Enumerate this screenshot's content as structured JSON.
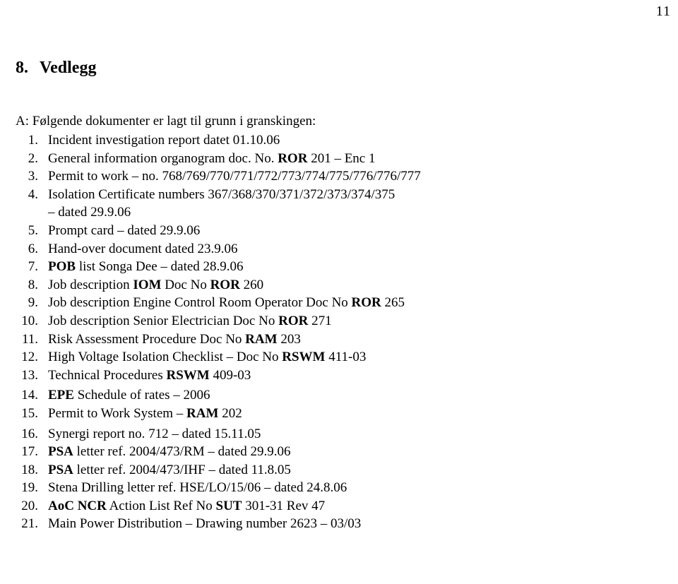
{
  "page": {
    "number": "11"
  },
  "heading": {
    "number": "8.",
    "title": "Vedlegg"
  },
  "intro": {
    "text": "A: Følgende dokumenter er lagt til grunn i granskingen:"
  },
  "list": {
    "items": [
      {
        "num": "1.",
        "text": "Incident investigation report datet 01.10.06"
      },
      {
        "num": "2.",
        "text": "General information organogram doc. No. ROR 201 – Enc 1"
      },
      {
        "num": "3.",
        "text": "Permit to work – no. 768/769/770/771/772/773/774/775/776/776/777"
      },
      {
        "num": "4.",
        "text": "Isolation Certificate numbers 367/368/370/371/372/373/374/375",
        "continuation": "– dated 29.9.06"
      },
      {
        "num": "5.",
        "text": "Prompt card – dated 29.9.06"
      },
      {
        "num": "6.",
        "text": "Hand-over document dated 23.9.06"
      },
      {
        "num": "7.",
        "text": "POB list Songa Dee – dated 28.9.06"
      },
      {
        "num": "8.",
        "text": "Job description IOM Doc No ROR 260"
      },
      {
        "num": "9.",
        "text": "Job description Engine Control Room Operator Doc No ROR 265"
      },
      {
        "num": "10.",
        "text": "Job description Senior Electrician Doc No ROR 271"
      },
      {
        "num": "11.",
        "text": "Risk Assessment Procedure Doc No RAM 203"
      },
      {
        "num": "12.",
        "text": "High Voltage Isolation Checklist – Doc No RSWM 411-03"
      },
      {
        "num": "13.",
        "text": "Technical Procedures RSWM 409-03"
      },
      {
        "num": "14.",
        "text": "EPE Schedule of rates – 2006"
      },
      {
        "num": "15.",
        "text": "Permit to Work System – RAM 202"
      },
      {
        "num": "16.",
        "text": "Synergi report no. 712 – dated 15.11.05"
      },
      {
        "num": "17.",
        "text": "PSA letter ref. 2004/473/RM – dated 29.9.06"
      },
      {
        "num": "18.",
        "text": "PSA letter ref. 2004/473/IHF – dated 11.8.05"
      },
      {
        "num": "19.",
        "text": "Stena Drilling letter ref. HSE/LO/15/06 – dated 24.8.06"
      },
      {
        "num": "20.",
        "text": "AoC NCR Action List Ref No SUT 301-31 Rev 47"
      },
      {
        "num": "21.",
        "text": "Main Power Distribution – Drawing number 2623 – 03/03"
      }
    ]
  }
}
